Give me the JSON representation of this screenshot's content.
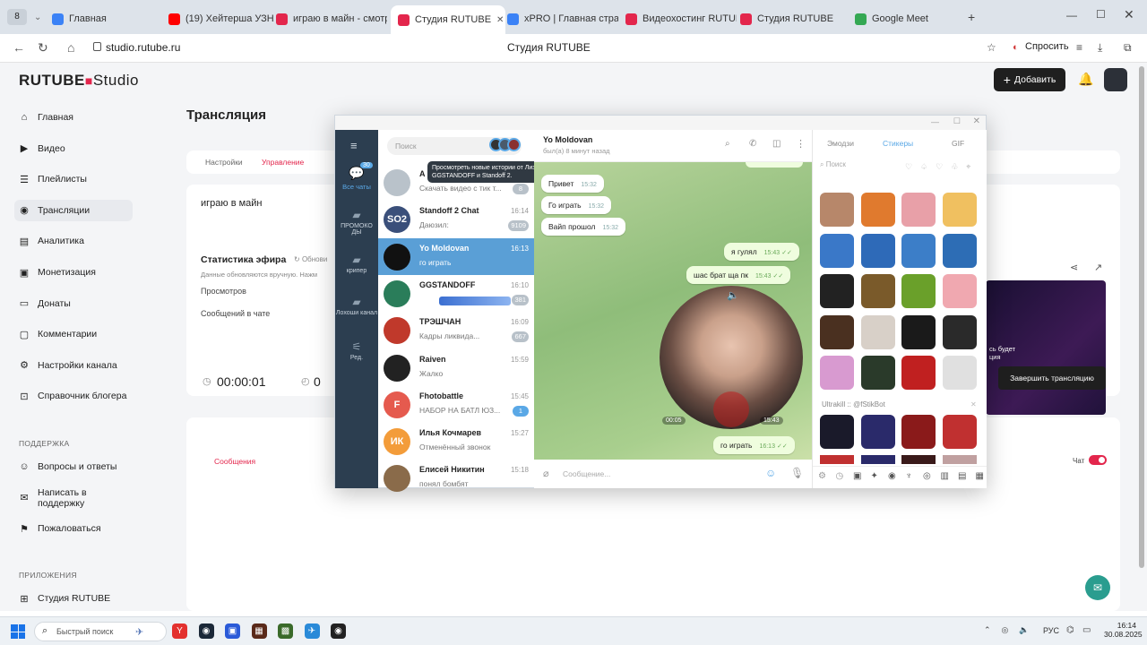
{
  "browser": {
    "tabs": [
      {
        "label": "Главная",
        "color": "#3b82f6"
      },
      {
        "label": "(19) Хейтерша УЗНАЛА",
        "color": "#ff0000"
      },
      {
        "label": "играю в майн - смотрет",
        "color": "#e3264c"
      },
      {
        "label": "Студия RUTUBE",
        "color": "#e3264c"
      },
      {
        "label": "xPRO | Главная страниц",
        "color": "#3b82f6"
      },
      {
        "label": "Видеохостинг RUTUBE.",
        "color": "#e3264c"
      },
      {
        "label": "Студия RUTUBE",
        "color": "#e3264c"
      },
      {
        "label": "Google Meet",
        "color": "#34a853"
      }
    ],
    "tab_count": "8",
    "url": "studio.rutube.ru",
    "page_title": "Студия RUTUBE",
    "ask_label": "Спросить"
  },
  "studio": {
    "logo": "RUTUBE",
    "logo_studio": "Studio",
    "add_button": "Добавить",
    "sidebar": [
      {
        "label": "Главная",
        "icon": "home-icon"
      },
      {
        "label": "Видео",
        "icon": "video-icon"
      },
      {
        "label": "Плейлисты",
        "icon": "playlist-icon"
      },
      {
        "label": "Трансляции",
        "icon": "broadcast-icon"
      },
      {
        "label": "Аналитика",
        "icon": "analytics-icon"
      },
      {
        "label": "Монетизация",
        "icon": "money-icon"
      },
      {
        "label": "Донаты",
        "icon": "donate-icon"
      },
      {
        "label": "Комментарии",
        "icon": "comments-icon"
      },
      {
        "label": "Настройки канала",
        "icon": "gear-icon"
      },
      {
        "label": "Справочник блогера",
        "icon": "book-icon"
      }
    ],
    "support_header": "ПОДДЕРЖКА",
    "support": [
      {
        "label": "Вопросы и ответы"
      },
      {
        "label": "Написать в поддержку"
      },
      {
        "label": "Пожаловаться"
      }
    ],
    "apps_header": "ПРИЛОЖЕНИЯ",
    "apps": [
      {
        "label": "Студия RUTUBE"
      }
    ],
    "page_title": "Трансляция",
    "tabs": [
      "Настройки",
      "Управление"
    ],
    "stream_title": "играю в майн",
    "stats_title": "Статистика эфира",
    "refresh_label": "Обнови",
    "stats_note": "Данные обновляются вручную. Нажм",
    "stat_views": "Просмотров",
    "stat_chat": "Сообщений в чате",
    "timer": "00:00:01",
    "viewers": "0",
    "preview_text": "сь будет\nция",
    "end_button": "Завершить трансляцию",
    "messages_tab": "Сообщения",
    "chat_label": "Чат",
    "brand_color": "#e3264c"
  },
  "telegram": {
    "search_placeholder": "Поиск",
    "stories_tooltip": "Просмотреть новые истории от Лиза, GGSTANDOFF и Standoff 2.",
    "folders": [
      {
        "label": "Все чаты",
        "badge": "30"
      },
      {
        "label": "ПРОМОКО ДЫ"
      },
      {
        "label": "крипер"
      },
      {
        "label": "Лохоши канал"
      },
      {
        "label": "Ред."
      }
    ],
    "chats": [
      {
        "name": "А",
        "msg": "Скачать видео с тик т...",
        "time": "",
        "badge": "8",
        "ava": "#b9c2ca",
        "ini": ""
      },
      {
        "name": "Standoff 2 Chat",
        "msg": "Даюзил:",
        "time": "16:14",
        "badge": "9109",
        "ava": "#3a4f7a",
        "ini": "SO2"
      },
      {
        "name": "Yo Moldovan",
        "msg": "го играть",
        "time": "16:13",
        "badge": "",
        "ava": "#111111",
        "ini": ""
      },
      {
        "name": "GGSTANDOFF",
        "msg": "",
        "time": "16:10",
        "badge": "381",
        "ava": "#2a7d5a",
        "ini": ""
      },
      {
        "name": "ТРЭШЧАН",
        "msg": "Кадры ликвида...",
        "time": "16:09",
        "badge": "667",
        "ava": "#c0392b",
        "ini": ""
      },
      {
        "name": "Raiven",
        "msg": "Жалко",
        "time": "15:59",
        "badge": "",
        "ava": "#222222",
        "ini": ""
      },
      {
        "name": "Fhotobattle",
        "msg": "НАБОР НА БАТЛ ЮЗ...",
        "time": "15:45",
        "badge": "1",
        "ava": "#e55a4e",
        "ini": "F"
      },
      {
        "name": "Илья Кочмарев",
        "msg": "Отменённый звонок",
        "time": "15:27",
        "badge": "",
        "ava": "#f39c3a",
        "ini": "ИК"
      },
      {
        "name": "Елисей Никитин",
        "msg": "понял бомбят",
        "time": "15:18",
        "badge": "",
        "ava": "#8a6b4a",
        "ini": ""
      }
    ],
    "conv_name": "Yo Moldovan",
    "conv_status": "был(а) 8 минут назад",
    "messages": [
      {
        "text": "Привет",
        "time": "15:32",
        "out": false
      },
      {
        "text": "Го играть",
        "time": "15:32",
        "out": false
      },
      {
        "text": "Вайп прошол",
        "time": "15:32",
        "out": false
      },
      {
        "text": "я гулял",
        "time": "15:43",
        "out": true
      },
      {
        "text": "шас брат ща пк",
        "time": "15:43",
        "out": true
      },
      {
        "text": "го играть",
        "time": "16:13",
        "out": true
      }
    ],
    "video_duration": "00:05",
    "video_time": "15:43",
    "input_placeholder": "Сообщение...",
    "sticker_tabs": [
      "Эмодзи",
      "Стикеры",
      "GIF"
    ],
    "sticker_search": "Поиск",
    "sticker_pack": "Ultrakill :: @fStikBot"
  },
  "taskbar": {
    "search": "Быстрый поиск",
    "lang": "РУС",
    "time": "16:14",
    "date": "30.08.2025"
  }
}
